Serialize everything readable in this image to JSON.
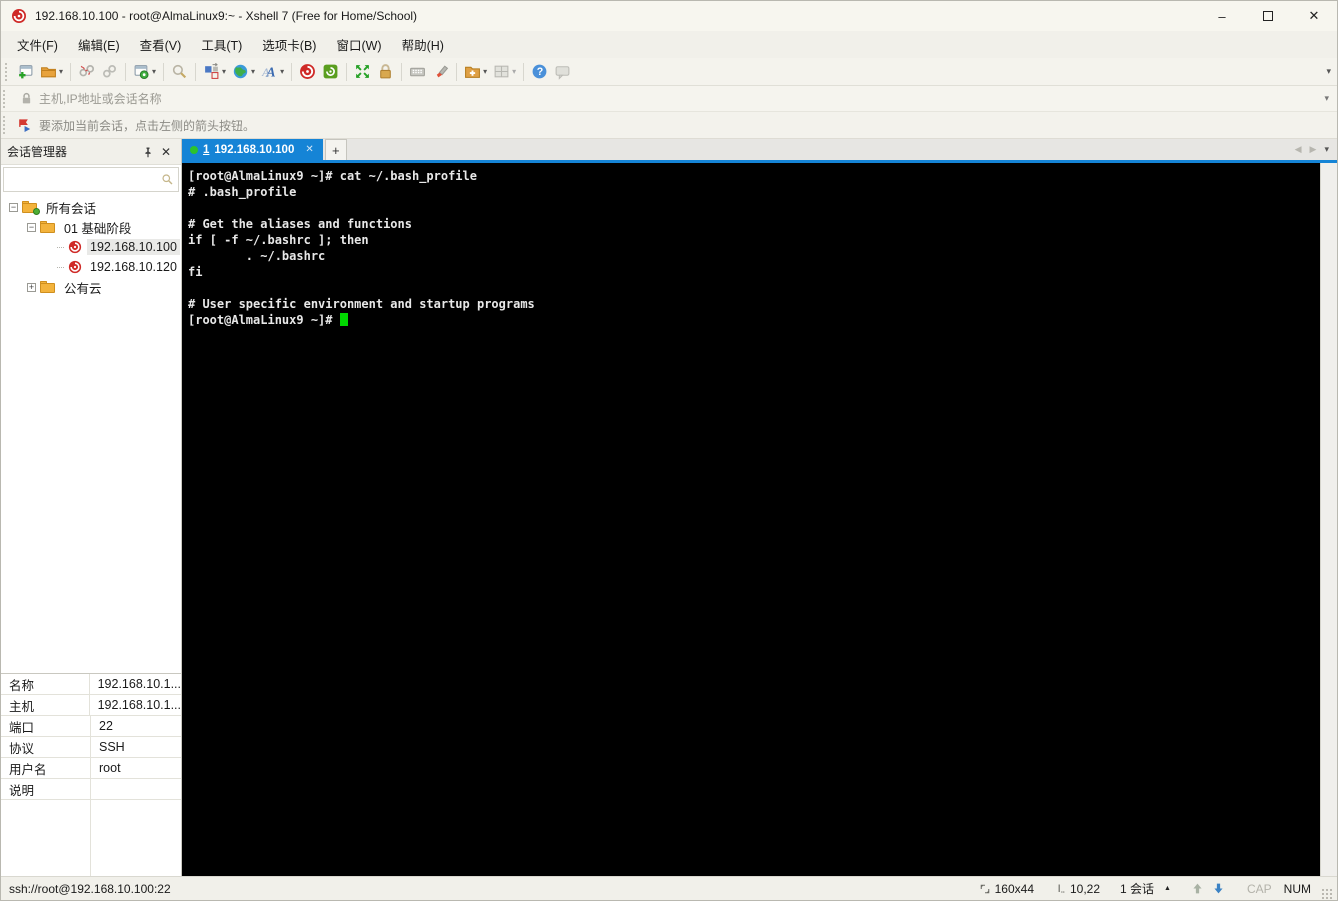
{
  "window": {
    "title": "192.168.10.100 - root@AlmaLinux9:~ - Xshell 7 (Free for Home/School)",
    "controls": {
      "minimize": "–",
      "close": "✕"
    }
  },
  "menu": {
    "items": [
      "文件(F)",
      "编辑(E)",
      "查看(V)",
      "工具(T)",
      "选项卡(B)",
      "窗口(W)",
      "帮助(H)"
    ]
  },
  "toolbar": {
    "icons": [
      "new-session",
      "open-folder",
      "disconnect",
      "reconnect",
      "session-properties",
      "find",
      "arrange-transfer",
      "web-browser",
      "font",
      "xshell-app",
      "xftp-app",
      "fullscreen",
      "lock-screen",
      "virtual-keyboard",
      "highlight-pen",
      "new-session-folder",
      "layout-grid",
      "help",
      "feedback"
    ]
  },
  "addressbar": {
    "placeholder": "主机,IP地址或会话名称"
  },
  "infobar": {
    "message": "要添加当前会话，点击左侧的箭头按钮。"
  },
  "session_manager": {
    "title": "会话管理器",
    "tree": {
      "root": "所有会话",
      "folder1": "01 基础阶段",
      "session1": "192.168.10.100",
      "session2": "192.168.10.120",
      "folder2": "公有云"
    },
    "glyphs": {
      "collapse": "−",
      "expand": "+",
      "close": "✕"
    }
  },
  "tabbar": {
    "active_index": "1",
    "active_label": "192.168.10.100",
    "close": "✕",
    "new_tab": "+"
  },
  "terminal": {
    "lines": [
      "[root@AlmaLinux9 ~]# cat ~/.bash_profile",
      "# .bash_profile",
      "",
      "# Get the aliases and functions",
      "if [ -f ~/.bashrc ]; then",
      "        . ~/.bashrc",
      "fi",
      "",
      "# User specific environment and startup programs",
      "[root@AlmaLinux9 ~]# "
    ]
  },
  "properties": {
    "rows": [
      {
        "label": "名称",
        "value": "192.168.10.1..."
      },
      {
        "label": "主机",
        "value": "192.168.10.1..."
      },
      {
        "label": "端口",
        "value": "22"
      },
      {
        "label": "协议",
        "value": "SSH"
      },
      {
        "label": "用户名",
        "value": "root"
      },
      {
        "label": "说明",
        "value": ""
      }
    ]
  },
  "statusbar": {
    "url": "ssh://root@192.168.10.100:22",
    "terminal_size": "160x44",
    "cursor_position": "10,22",
    "session_count": "1 会话",
    "dropdown": "▲",
    "cap": "CAP",
    "num": "NUM"
  },
  "colors": {
    "accent_blue": "#1584d6",
    "cursor_green": "#00d800",
    "tab_dot_green": "#2cc32c",
    "terminal_bg": "#000000",
    "terminal_fg": "#e8e8e8",
    "xshell_red": "#cf2a27",
    "xftp_green": "#5a9e1f",
    "folder_orange": "#f3b33c"
  }
}
